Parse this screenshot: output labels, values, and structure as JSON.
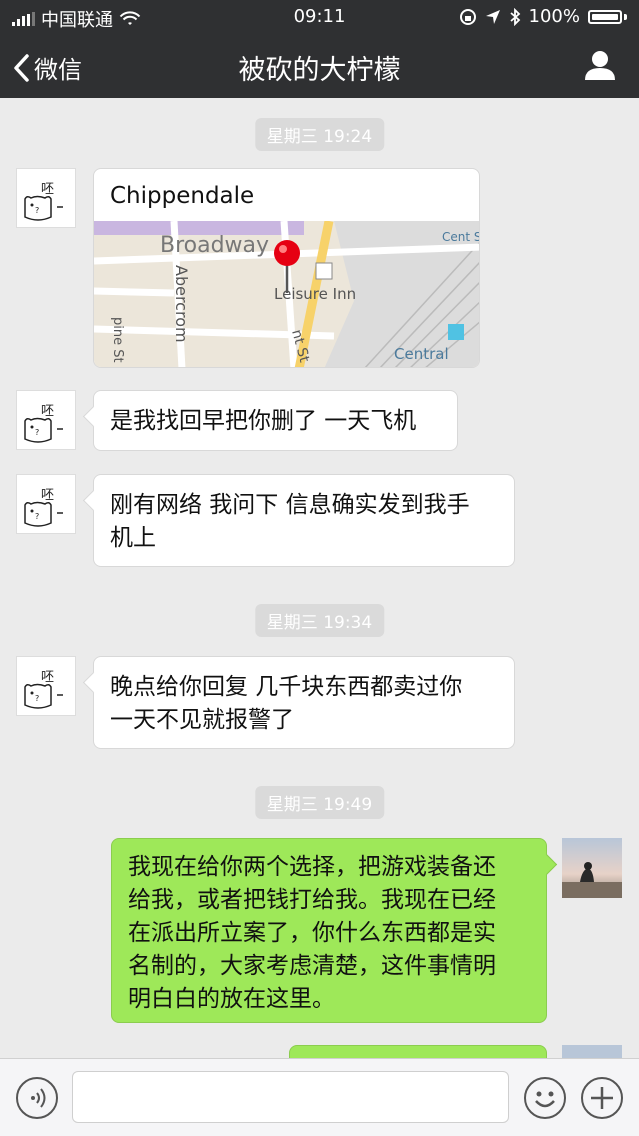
{
  "status_bar": {
    "carrier": "中国联通",
    "time": "09:11",
    "battery": "100%"
  },
  "nav": {
    "back_label": "微信",
    "title": "被砍的大柠檬"
  },
  "messages": {
    "ts1": "星期三 19:24",
    "location": {
      "title": "Chippendale",
      "map_labels": {
        "broadway": "Broadway",
        "leisure_inn": "Leisure Inn",
        "abercrom": "Abercrom",
        "central_station": "Cent Stati Platf",
        "central": "Central",
        "pine_st": "pine St",
        "nt_st": "nt St"
      }
    },
    "m1": "是我找回早把你删了 一天飞机",
    "m2_line1": "刚有网络 我问下 信息确实发到我手",
    "m2_line2": "机上",
    "ts2": "星期三 19:34",
    "m3_line1": "晚点给你回复 几千块东西都卖过你",
    "m3_line2": "一天不见就报警了",
    "ts3": "星期三 19:49",
    "m4_lines": [
      "我现在给你两个选择，把游戏装备还",
      "给我，或者把钱打给我。我现在已经",
      "在派出所立案了，你什么东西都是实",
      "名制的，大家考虑清楚，这件事情明",
      "明白白的放在这里。"
    ]
  },
  "avatar_text": "呸",
  "colors": {
    "nav_bg": "#2f3032",
    "chat_bg": "#ebebeb",
    "sent_bubble": "#9ee859",
    "received_bubble": "#ffffff"
  },
  "icons": {
    "back": "chevron-left-icon",
    "profile": "person-icon",
    "voice": "voice-icon",
    "emoji": "smile-icon",
    "add": "plus-icon",
    "map_pin": "map-pin-icon"
  }
}
